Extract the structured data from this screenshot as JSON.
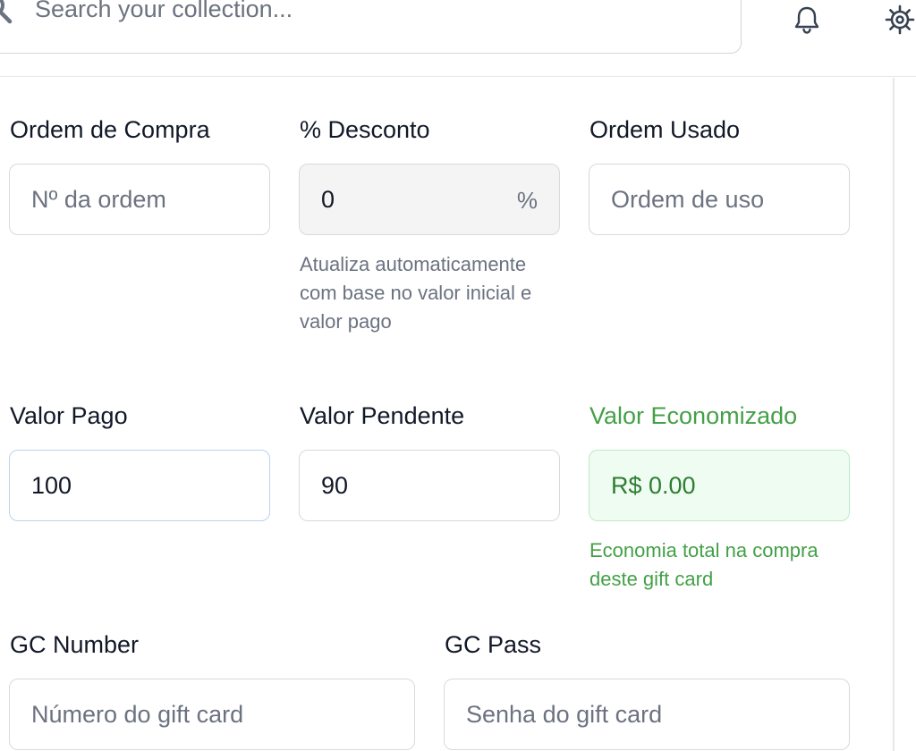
{
  "header": {
    "search_placeholder": "Search your collection...",
    "icons": [
      "search-icon",
      "bell-icon",
      "gear-icon"
    ]
  },
  "form": {
    "purchase_order": {
      "label": "Ordem de Compra",
      "placeholder": "Nº da ordem",
      "value": ""
    },
    "discount": {
      "label": "% Desconto",
      "value": "0",
      "suffix": "%",
      "hint": "Atualiza automaticamente com base no valor inicial e valor pago"
    },
    "used_order": {
      "label": "Ordem Usado",
      "placeholder": "Ordem de uso",
      "value": ""
    },
    "paid_value": {
      "label": "Valor Pago",
      "value": "100"
    },
    "pending_value": {
      "label": "Valor Pendente",
      "value": "90"
    },
    "saved_value": {
      "label": "Valor Economizado",
      "value": "R$ 0.00",
      "hint": "Economia total na compra deste gift card"
    },
    "gc_number": {
      "label": "GC Number",
      "placeholder": "Número do gift card",
      "value": ""
    },
    "gc_pass": {
      "label": "GC Pass",
      "placeholder": "Senha do gift card",
      "value": ""
    }
  },
  "colors": {
    "accent_green": "#43a047",
    "success_bg": "#effcf2",
    "focus_border": "#b9d3ef",
    "readonly_bg": "#f4f4f5"
  }
}
